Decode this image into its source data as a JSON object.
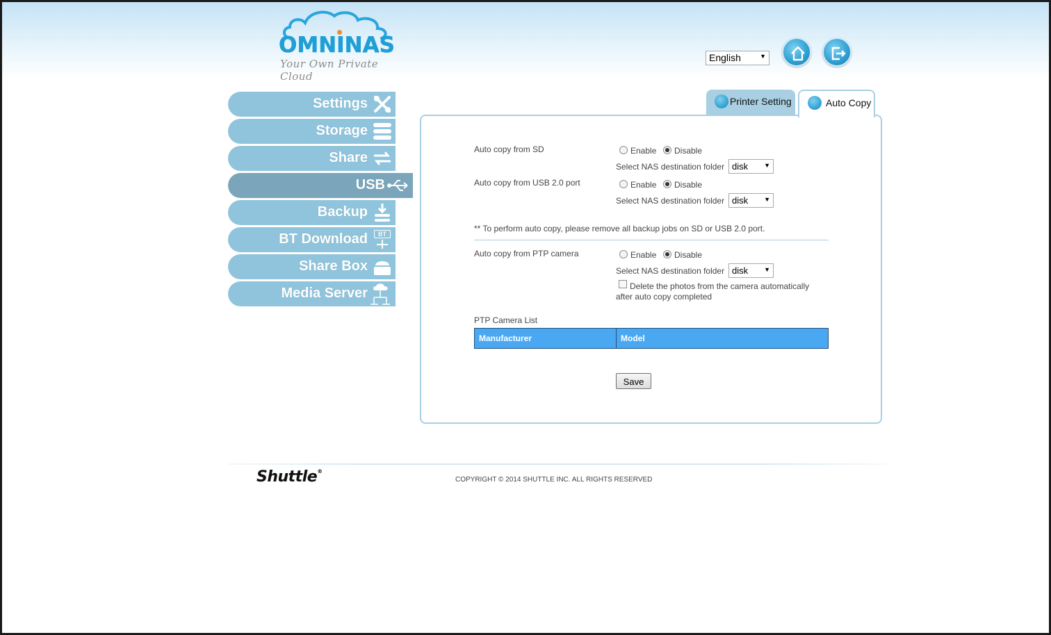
{
  "brand": {
    "name": "OMNINAS",
    "tagline": "Your Own Private Cloud"
  },
  "header": {
    "language": "English"
  },
  "sidebar": {
    "items": [
      {
        "label": "Settings"
      },
      {
        "label": "Storage"
      },
      {
        "label": "Share"
      },
      {
        "label": "USB"
      },
      {
        "label": "Backup"
      },
      {
        "label": "BT Download"
      },
      {
        "label": "Share Box"
      },
      {
        "label": "Media Server"
      }
    ],
    "bt_badge": "BT"
  },
  "tabs": {
    "printer": "Printer Setting",
    "autocopy": "Auto Copy"
  },
  "form": {
    "sd_label": "Auto copy from SD",
    "usb_label": "Auto copy from USB 2.0 port",
    "ptp_label": "Auto copy from PTP camera",
    "enable": "Enable",
    "disable": "Disable",
    "dest_label": "Select NAS destination folder",
    "folder_value": "disk",
    "note": "** To perform auto copy, please remove all backup jobs on SD or USB 2.0 port.",
    "delete_line1": "Delete the photos from the camera automatically",
    "delete_line2": "after auto copy completed",
    "camera_list_title": "PTP Camera List",
    "col_manufacturer": "Manufacturer",
    "col_model": "Model",
    "save": "Save"
  },
  "footer": {
    "brand": "Shuttle",
    "copyright": "COPYRIGHT © 2014 SHUTTLE INC. ALL RIGHTS RESERVED"
  }
}
